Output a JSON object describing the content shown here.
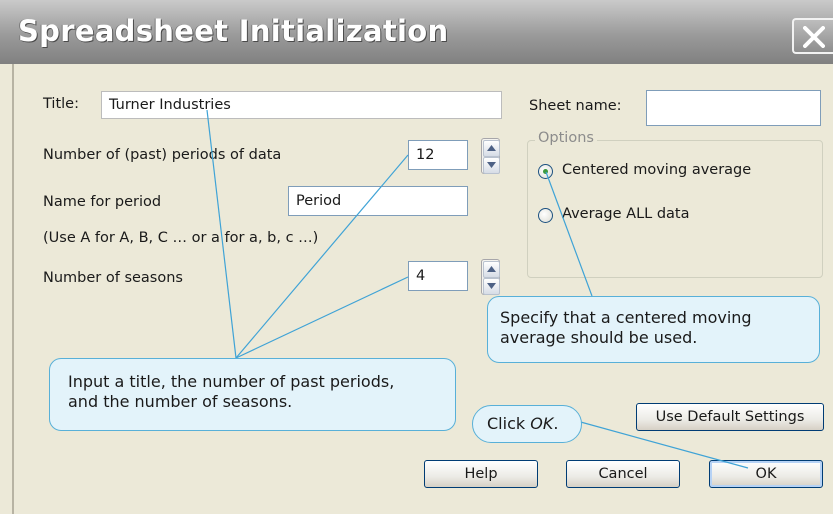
{
  "dialog": {
    "title": "Spreadsheet Initialization"
  },
  "form": {
    "title_label": "Title:",
    "title_value": "Turner Industries",
    "periods_label": "Number of (past) periods of data",
    "periods_value": "12",
    "period_name_label": "Name for period",
    "period_name_value": "Period",
    "period_hint": "(Use A for A, B, C … or a for a, b, c …)",
    "seasons_label": "Number of seasons",
    "seasons_value": "4",
    "sheet_name_label": "Sheet name:",
    "sheet_name_value": ""
  },
  "options": {
    "legend": "Options",
    "radios": [
      {
        "label": "Centered moving average",
        "selected": true
      },
      {
        "label": "Average ALL data",
        "selected": false
      }
    ]
  },
  "buttons": {
    "defaults": "Use Default Settings",
    "help": "Help",
    "cancel": "Cancel",
    "ok": "OK"
  },
  "callouts": {
    "left_line1": "Input a title, the number of past periods,",
    "left_line2": "and the number of seasons.",
    "right_line1": "Specify that a centered moving",
    "right_line2": "average should be used.",
    "ok_prefix": "Click ",
    "ok_word": "OK",
    "ok_suffix": "."
  },
  "colors": {
    "dialog_bg": "#ece9d8",
    "titlebar": "#9a9a9a",
    "callout_fill": "#e3f3fa",
    "callout_border": "#58b0d8",
    "pointer_line": "#3fa3d6",
    "radio_dot": "#3d9a3d"
  },
  "icons": [
    "close-icon",
    "spin-up-icon",
    "spin-down-icon"
  ]
}
